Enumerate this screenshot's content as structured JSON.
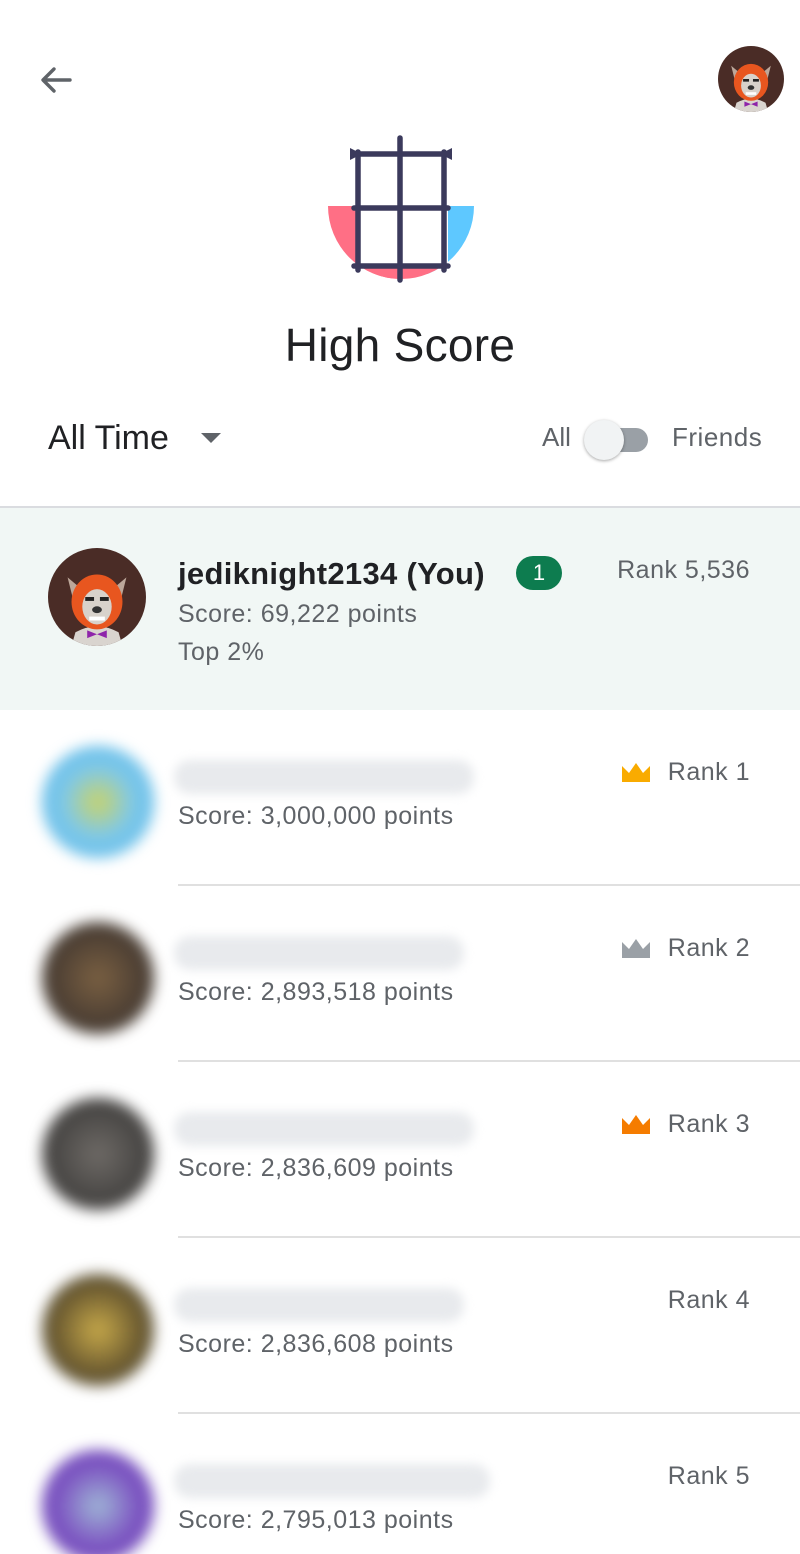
{
  "header": {
    "title": "High Score"
  },
  "filters": {
    "time_range": "All Time",
    "toggle_left_label": "All",
    "toggle_right_label": "Friends",
    "toggle_friends_on": false
  },
  "current_user": {
    "name": "jediknight2134 (You)",
    "badge": "1",
    "score": "Score: 69,222 points",
    "percentile": "Top 2%",
    "rank": "Rank 5,536"
  },
  "leaderboard": [
    {
      "score": "Score: 3,000,000 points",
      "rank": "Rank 1",
      "crown": "gold-crown-icon",
      "crown_color": "#f9ab00",
      "avatar_color": "#4fc3f7"
    },
    {
      "score": "Score: 2,893,518 points",
      "rank": "Rank 2",
      "crown": "silver-crown-icon",
      "crown_color": "#9aa0a6",
      "avatar_color": "#5d4a3a"
    },
    {
      "score": "Score: 2,836,609 points",
      "rank": "Rank 3",
      "crown": "bronze-crown-icon",
      "crown_color": "#f57c00",
      "avatar_color": "#4a4a4a"
    },
    {
      "score": "Score: 2,836,608 points",
      "rank": "Rank 4",
      "crown": "",
      "crown_color": "",
      "avatar_color": "#6b5a30"
    },
    {
      "score": "Score: 2,795,013 points",
      "rank": "Rank 5",
      "crown": "",
      "crown_color": "",
      "avatar_color": "#7e57c2"
    }
  ],
  "colors": {
    "you_row_bg": "#f1f7f5",
    "badge_green": "#0d7c4f",
    "logo_pink": "#ff6f85",
    "logo_blue": "#5ec8ff",
    "logo_grid": "#3b3a5c"
  }
}
